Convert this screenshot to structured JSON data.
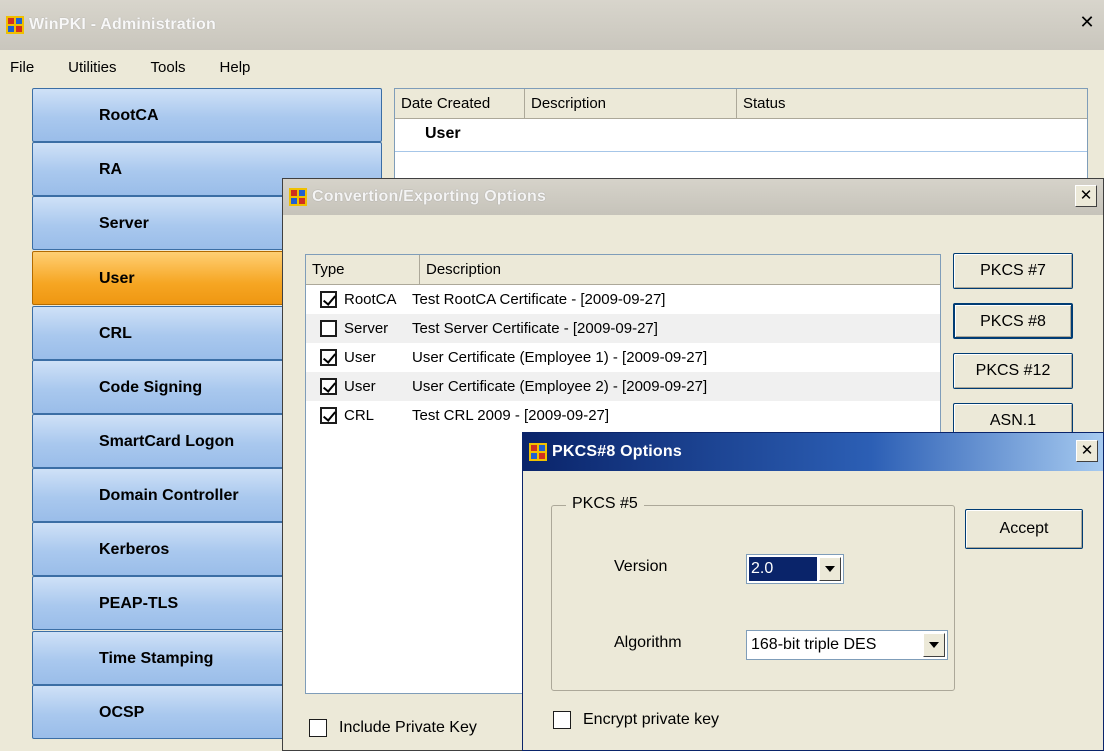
{
  "main_window": {
    "title": "WinPKI - Administration",
    "menu": [
      "File",
      "Utilities",
      "Tools",
      "Help"
    ],
    "sidebar": [
      {
        "label": "RootCA",
        "active": false
      },
      {
        "label": "RA",
        "active": false
      },
      {
        "label": "Server",
        "active": false
      },
      {
        "label": "User",
        "active": true
      },
      {
        "label": "CRL",
        "active": false
      },
      {
        "label": "Code Signing",
        "active": false
      },
      {
        "label": "SmartCard Logon",
        "active": false
      },
      {
        "label": "Domain Controller",
        "active": false
      },
      {
        "label": "Kerberos",
        "active": false
      },
      {
        "label": "PEAP-TLS",
        "active": false
      },
      {
        "label": "Time Stamping",
        "active": false
      },
      {
        "label": "OCSP",
        "active": false
      }
    ],
    "list": {
      "columns": [
        "Date Created",
        "Description",
        "Status"
      ],
      "group": "User"
    }
  },
  "convert_dialog": {
    "title": "Convertion/Exporting Options",
    "columns": [
      "Type",
      "Description"
    ],
    "rows": [
      {
        "checked": true,
        "type": "RootCA",
        "description": "Test RootCA Certificate - [2009-09-27]"
      },
      {
        "checked": false,
        "type": "Server",
        "description": "Test Server Certificate - [2009-09-27]"
      },
      {
        "checked": true,
        "type": "User",
        "description": "User Certificate (Employee 1) - [2009-09-27]"
      },
      {
        "checked": true,
        "type": "User",
        "description": "User Certificate (Employee 2) - [2009-09-27]"
      },
      {
        "checked": true,
        "type": "CRL",
        "description": "Test CRL 2009 - [2009-09-27]"
      }
    ],
    "buttons": [
      "PKCS #7",
      "PKCS #8",
      "PKCS #12",
      "ASN.1"
    ],
    "include_private_key": {
      "label": "Include Private Key",
      "checked": false
    }
  },
  "pkcs8_dialog": {
    "title": "PKCS#8 Options",
    "group_label": "PKCS #5",
    "version_label": "Version",
    "version_value": "2.0",
    "algorithm_label": "Algorithm",
    "algorithm_value": "168-bit triple DES",
    "accept_label": "Accept",
    "encrypt_label": "Encrypt private key",
    "encrypt_checked": false
  },
  "colors": {
    "sidebar_button": "#a9c8ee",
    "sidebar_active": "#f6a623",
    "active_titlebar": "#0a246a",
    "window_bg": "#ece9d8"
  }
}
